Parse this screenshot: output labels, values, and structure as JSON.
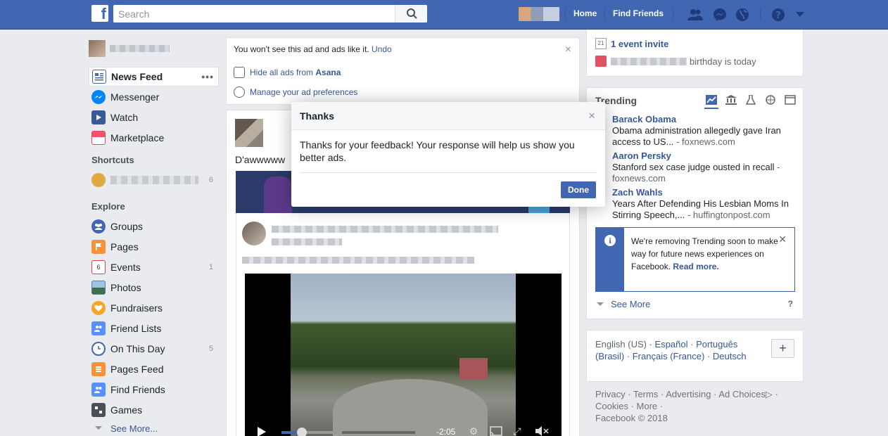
{
  "topbar": {
    "search_placeholder": "Search",
    "home": "Home",
    "find_friends": "Find Friends"
  },
  "left_nav": {
    "items": [
      {
        "label": "News Feed"
      },
      {
        "label": "Messenger"
      },
      {
        "label": "Watch"
      },
      {
        "label": "Marketplace"
      }
    ],
    "shortcuts_heading": "Shortcuts",
    "shortcut_count": "6",
    "explore_heading": "Explore",
    "explore": [
      {
        "label": "Groups",
        "count": ""
      },
      {
        "label": "Pages",
        "count": ""
      },
      {
        "label": "Events",
        "count": "1"
      },
      {
        "label": "Photos",
        "count": ""
      },
      {
        "label": "Fundraisers",
        "count": ""
      },
      {
        "label": "Friend Lists",
        "count": ""
      },
      {
        "label": "On This Day",
        "count": "5"
      },
      {
        "label": "Pages Feed",
        "count": ""
      },
      {
        "label": "Find Friends",
        "count": ""
      },
      {
        "label": "Games",
        "count": ""
      }
    ],
    "see_more": "See More...",
    "events_icon_num": "6"
  },
  "ad_hidden": {
    "message": "You won't see this ad and ads like it.",
    "undo": "Undo",
    "hide_all_prefix": "Hide all ads from",
    "advertiser": "Asana",
    "manage": "Manage your ad preferences"
  },
  "post": {
    "caption": "D'awwwww",
    "video_time": "-2:05",
    "progress": 0.15
  },
  "events": {
    "invite": "1 event invite",
    "birthday_suffix": "birthday is today",
    "calendar_num": "21"
  },
  "trending": {
    "heading": "Trending",
    "topics": [
      {
        "title": "Barack Obama",
        "headline": "Obama administration allegedly gave Iran access to US...",
        "source": "foxnews.com"
      },
      {
        "title": "Aaron Persky",
        "headline": "Stanford sex case judge ousted in recall",
        "source": "foxnews.com"
      },
      {
        "title": "Zach Wahls",
        "headline": "Years After Defending His Lesbian Moms In Stirring Speech,...",
        "source": "huffingtonpost.com"
      }
    ],
    "notice_text": "We're removing Trending soon to make way for future news experiences on Facebook.",
    "notice_link": "Read more.",
    "see_more": "See More",
    "help": "?"
  },
  "languages": {
    "current": "English (US)",
    "options": [
      "Español",
      "Português (Brasil)",
      "Français (France)",
      "Deutsch"
    ]
  },
  "footer": {
    "links": [
      "Privacy",
      "Terms",
      "Advertising",
      "Ad Choices",
      "Cookies",
      "More"
    ],
    "copyright": "Facebook © 2018"
  },
  "dialog": {
    "title": "Thanks",
    "body": "Thanks for your feedback! Your response will help us show you better ads.",
    "done": "Done"
  },
  "colors": {
    "brand": "#4267b2",
    "link": "#365899",
    "background": "#e9ebee"
  }
}
